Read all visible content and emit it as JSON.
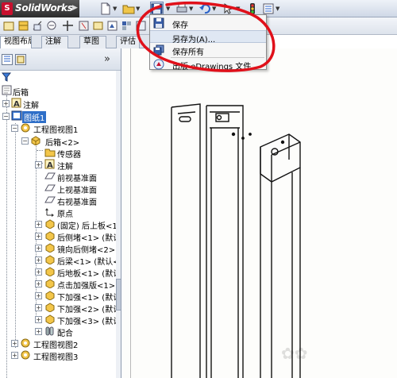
{
  "app": {
    "name": "SolidWorks"
  },
  "save_menu": {
    "items": [
      {
        "label": "保存",
        "icon": "floppy-disk-icon"
      },
      {
        "label": "另存为(A)...",
        "icon": "none",
        "highlighted": true
      },
      {
        "label": "保存所有",
        "icon": "multi-floppy-icon"
      },
      {
        "label": "出版 eDrawings 文件",
        "icon": "edrawings-icon"
      }
    ]
  },
  "tabs": [
    {
      "label": "视图布局",
      "active": true
    },
    {
      "label": "注解",
      "active": false
    },
    {
      "label": "草图",
      "active": false
    },
    {
      "label": "评估",
      "active": false
    }
  ],
  "panel": {
    "expand_glyph": "»"
  },
  "tree": {
    "root": "后箱",
    "annotations": "注解",
    "sheet": "图纸1",
    "view1": "工程图视图1",
    "part": "后箱<2>",
    "part_children": [
      {
        "label": "传感器",
        "icon": "sensor-folder-icon"
      },
      {
        "label": "注解",
        "icon": "annotation-icon"
      },
      {
        "label": "前视基准面",
        "icon": "plane-icon"
      },
      {
        "label": "上视基准面",
        "icon": "plane-icon"
      },
      {
        "label": "右视基准面",
        "icon": "plane-icon"
      },
      {
        "label": "原点",
        "icon": "origin-icon"
      }
    ],
    "components": [
      "(固定) 后上板<1",
      "后侧堵<1> (默认",
      "镜向后侧堵<2>",
      "后梁<1> (默认<",
      "后地板<1> (默认",
      "点击加强版<1>",
      "下加强<1> (默认",
      "下加强<2> (默认",
      "下加强<3> (默认"
    ],
    "mates": "配合",
    "view2": "工程图视图2",
    "view3": "工程图视图3"
  },
  "colors": {
    "accent": "#2f6fc8",
    "callout_red": "#e0101a",
    "logo_red": "#c8102e"
  }
}
